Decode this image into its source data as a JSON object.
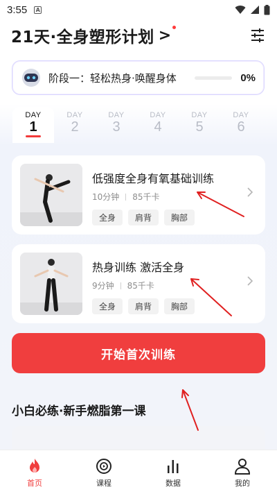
{
  "status_bar": {
    "time": "3:55",
    "notification_glyph": "A"
  },
  "header": {
    "title": "21天·全身塑形计划",
    "chevron": ">"
  },
  "stage": {
    "label": "阶段一：轻松热身·唤醒身体",
    "percent": "0%",
    "progress": 0
  },
  "days": [
    {
      "label": "DAY",
      "num": "1",
      "active": true
    },
    {
      "label": "DAY",
      "num": "2",
      "active": false
    },
    {
      "label": "DAY",
      "num": "3",
      "active": false
    },
    {
      "label": "DAY",
      "num": "4",
      "active": false
    },
    {
      "label": "DAY",
      "num": "5",
      "active": false
    },
    {
      "label": "DAY",
      "num": "6",
      "active": false
    }
  ],
  "workouts": [
    {
      "title": "低强度全身有氧基础训练",
      "duration": "10分钟",
      "calories": "85千卡",
      "tags": [
        "全身",
        "肩背",
        "胸部"
      ]
    },
    {
      "title": "热身训练 激活全身",
      "duration": "9分钟",
      "calories": "85千卡",
      "tags": [
        "全身",
        "肩背",
        "胸部"
      ]
    }
  ],
  "start_button": "开始首次训练",
  "section": {
    "title": "小白必练·新手燃脂第一课"
  },
  "nav": [
    {
      "label": "首页",
      "icon": "flame-icon",
      "active": true
    },
    {
      "label": "课程",
      "icon": "play-circle-icon",
      "active": false
    },
    {
      "label": "数据",
      "icon": "bar-chart-icon",
      "active": false
    },
    {
      "label": "我的",
      "icon": "person-icon",
      "active": false
    }
  ],
  "colors": {
    "accent": "#f03e3e",
    "inactive_day": "#b8bcc6",
    "annotation": "#e02020"
  }
}
